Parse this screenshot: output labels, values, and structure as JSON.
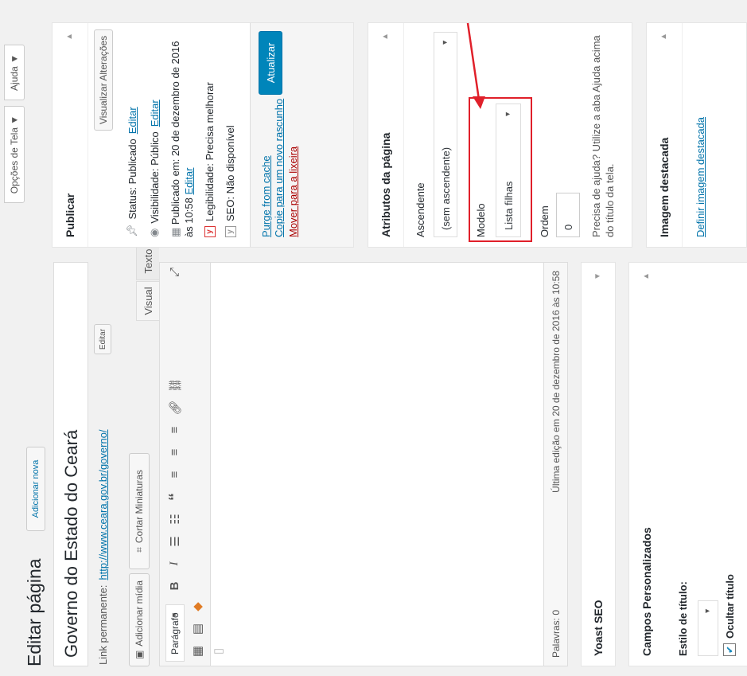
{
  "screen_options": {
    "label": "Opções de Tela ▼"
  },
  "help": {
    "label": "Ajuda ▼"
  },
  "page": {
    "title": "Editar página",
    "add_new": "Adicionar nova"
  },
  "post": {
    "title": "Governo do Estado do Ceará",
    "permalink_label": "Link permanente:",
    "permalink_url": "http://www.ceara.gov.br/governo/",
    "edit_slug": "Editar"
  },
  "editor": {
    "add_media": "Adicionar mídia",
    "crop_thumbs": "Cortar Miniaturas",
    "tab_visual": "Visual",
    "tab_text": "Texto",
    "format": "Parágrafo",
    "word_count": "Palavras: 0",
    "last_edit": "Última edição em 20 de dezembro de 2016 às 10:58"
  },
  "publish": {
    "title": "Publicar",
    "preview_changes": "Visualizar Alterações",
    "status": "Status: Publicado",
    "status_edit": "Editar",
    "visibility": "Visibilidade: Público",
    "visibility_edit": "Editar",
    "published_on": "Publicado em: 20 de dezembro de 2016 às 10:58",
    "published_edit": "Editar",
    "readability": "Legibilidade: Precisa melhorar",
    "seo": "SEO: Não disponível",
    "purge": "Purge from cache",
    "copy_draft": "Copie para um novo rascunho",
    "trash": "Mover para a lixeira",
    "update": "Atualizar"
  },
  "attributes": {
    "title": "Atributos da página",
    "parent_label": "Ascendente",
    "parent_value": "(sem ascendente)",
    "template_label": "Modelo",
    "template_value": "Lista filhas",
    "order_label": "Ordem",
    "order_value": "0",
    "help": "Precisa de ajuda? Utilize a aba Ajuda acima do título da tela."
  },
  "featured": {
    "title": "Imagem destacada",
    "set_link": "Definir imagem destacada"
  },
  "yoast": {
    "title": "Yoast SEO"
  },
  "custom_fields": {
    "title": "Campos Personalizados",
    "title_style_label": "Estilo de título:",
    "hide_title": "Ocultar título"
  },
  "colors": {
    "accent": "#0085ba",
    "link": "#0073aa",
    "trash": "#a00",
    "highlight": "#e0202a"
  }
}
